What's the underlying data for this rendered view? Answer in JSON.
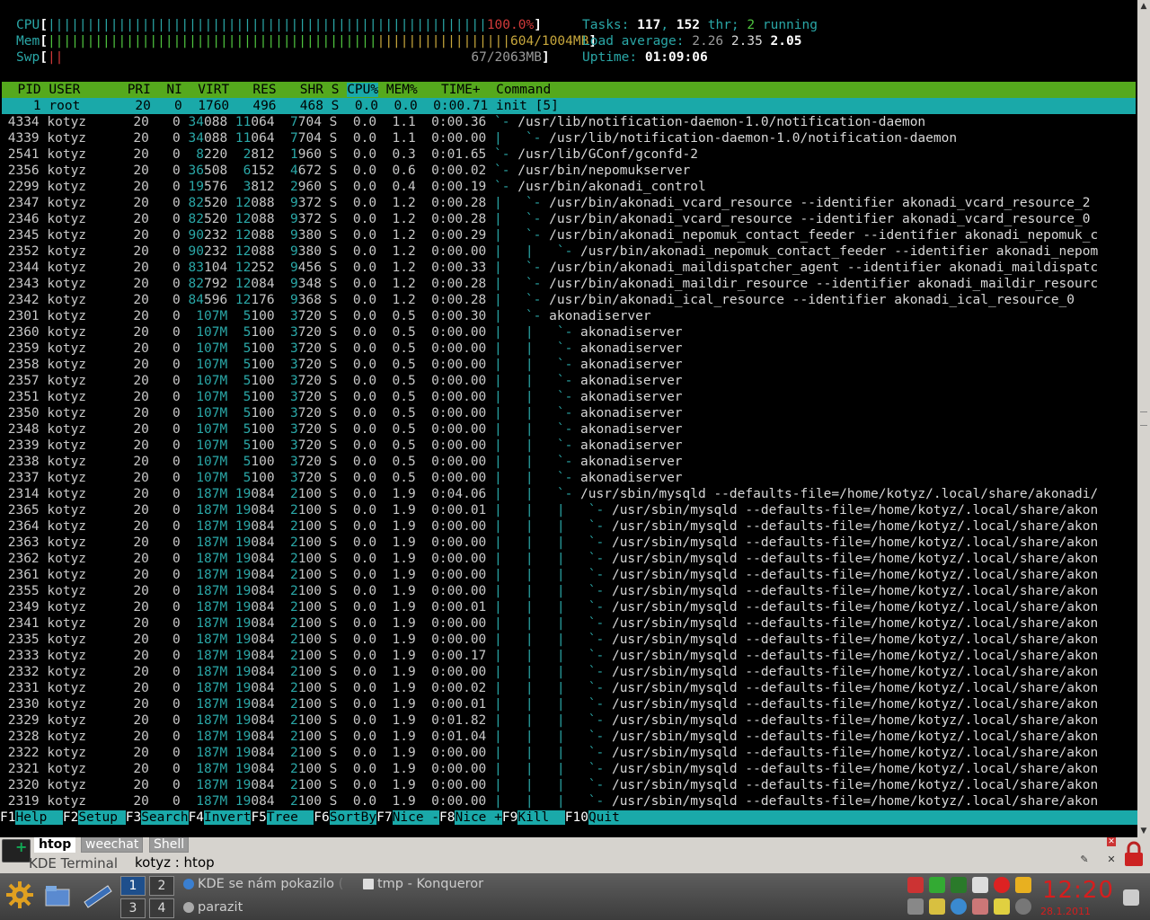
{
  "meters": {
    "cpu_label": "CPU",
    "cpu_bar": "||||||||||||||||||||||||||||||||||||||||||||||||||||||||",
    "cpu_value": "100.0%",
    "mem_label": "Mem",
    "mem_bar_green": "||||||||||||||||||||||||||||||||||||||||||",
    "mem_bar_yellow": "|||||||||||||||||",
    "mem_value": "604/1004MB",
    "swp_label": "Swp",
    "swp_bar": "||",
    "swp_value": "67/2063MB"
  },
  "stats": {
    "tasks_label": "Tasks:",
    "tasks": "117",
    "threads": "152",
    "thr_label": "thr;",
    "running": "2",
    "running_label": "running",
    "load_label": "Load average:",
    "load1": "2.26",
    "load5": "2.35",
    "load15": "2.05",
    "uptime_label": "Uptime:",
    "uptime": "01:09:06"
  },
  "columns": [
    "PID",
    "USER",
    "PRI",
    "NI",
    "VIRT",
    "RES",
    "SHR",
    "S",
    "CPU%",
    "MEM%",
    "TIME+",
    "Command"
  ],
  "processes": [
    {
      "pid": "1",
      "user": "root",
      "pri": "20",
      "ni": "0",
      "virt": "1760",
      "res": "496",
      "shr": "468",
      "s": "S",
      "cpu": "0.0",
      "mem": "0.0",
      "time": "0:00.71",
      "tree": "",
      "cmd": "init [5]"
    },
    {
      "pid": "4334",
      "user": "kotyz",
      "pri": "20",
      "ni": "0",
      "virt": "34088",
      "res": "11064",
      "shr": "7704",
      "s": "S",
      "cpu": "0.0",
      "mem": "1.1",
      "time": "0:00.36",
      "tree": "`- ",
      "cmd": "/usr/lib/notification-daemon-1.0/notification-daemon"
    },
    {
      "pid": "4339",
      "user": "kotyz",
      "pri": "20",
      "ni": "0",
      "virt": "34088",
      "res": "11064",
      "shr": "7704",
      "s": "S",
      "cpu": "0.0",
      "mem": "1.1",
      "time": "0:00.00",
      "tree": "|   `- ",
      "cmd": "/usr/lib/notification-daemon-1.0/notification-daemon"
    },
    {
      "pid": "2541",
      "user": "kotyz",
      "pri": "20",
      "ni": "0",
      "virt": "8220",
      "res": "2812",
      "shr": "1960",
      "s": "S",
      "cpu": "0.0",
      "mem": "0.3",
      "time": "0:01.65",
      "tree": "`- ",
      "cmd": "/usr/lib/GConf/gconfd-2"
    },
    {
      "pid": "2356",
      "user": "kotyz",
      "pri": "20",
      "ni": "0",
      "virt": "36508",
      "res": "6152",
      "shr": "4672",
      "s": "S",
      "cpu": "0.0",
      "mem": "0.6",
      "time": "0:00.02",
      "tree": "`- ",
      "cmd": "/usr/bin/nepomukserver"
    },
    {
      "pid": "2299",
      "user": "kotyz",
      "pri": "20",
      "ni": "0",
      "virt": "19576",
      "res": "3812",
      "shr": "2960",
      "s": "S",
      "cpu": "0.0",
      "mem": "0.4",
      "time": "0:00.19",
      "tree": "`- ",
      "cmd": "/usr/bin/akonadi_control"
    },
    {
      "pid": "2347",
      "user": "kotyz",
      "pri": "20",
      "ni": "0",
      "virt": "82520",
      "res": "12088",
      "shr": "9372",
      "s": "S",
      "cpu": "0.0",
      "mem": "1.2",
      "time": "0:00.28",
      "tree": "|   `- ",
      "cmd": "/usr/bin/akonadi_vcard_resource --identifier akonadi_vcard_resource_2"
    },
    {
      "pid": "2346",
      "user": "kotyz",
      "pri": "20",
      "ni": "0",
      "virt": "82520",
      "res": "12088",
      "shr": "9372",
      "s": "S",
      "cpu": "0.0",
      "mem": "1.2",
      "time": "0:00.28",
      "tree": "|   `- ",
      "cmd": "/usr/bin/akonadi_vcard_resource --identifier akonadi_vcard_resource_0"
    },
    {
      "pid": "2345",
      "user": "kotyz",
      "pri": "20",
      "ni": "0",
      "virt": "90232",
      "res": "12088",
      "shr": "9380",
      "s": "S",
      "cpu": "0.0",
      "mem": "1.2",
      "time": "0:00.29",
      "tree": "|   `- ",
      "cmd": "/usr/bin/akonadi_nepomuk_contact_feeder --identifier akonadi_nepomuk_c"
    },
    {
      "pid": "2352",
      "user": "kotyz",
      "pri": "20",
      "ni": "0",
      "virt": "90232",
      "res": "12088",
      "shr": "9380",
      "s": "S",
      "cpu": "0.0",
      "mem": "1.2",
      "time": "0:00.00",
      "tree": "|   |   `- ",
      "cmd": "/usr/bin/akonadi_nepomuk_contact_feeder --identifier akonadi_nepom"
    },
    {
      "pid": "2344",
      "user": "kotyz",
      "pri": "20",
      "ni": "0",
      "virt": "83104",
      "res": "12252",
      "shr": "9456",
      "s": "S",
      "cpu": "0.0",
      "mem": "1.2",
      "time": "0:00.33",
      "tree": "|   `- ",
      "cmd": "/usr/bin/akonadi_maildispatcher_agent --identifier akonadi_maildispatc"
    },
    {
      "pid": "2343",
      "user": "kotyz",
      "pri": "20",
      "ni": "0",
      "virt": "82792",
      "res": "12084",
      "shr": "9348",
      "s": "S",
      "cpu": "0.0",
      "mem": "1.2",
      "time": "0:00.28",
      "tree": "|   `- ",
      "cmd": "/usr/bin/akonadi_maildir_resource --identifier akonadi_maildir_resourc"
    },
    {
      "pid": "2342",
      "user": "kotyz",
      "pri": "20",
      "ni": "0",
      "virt": "84596",
      "res": "12176",
      "shr": "9368",
      "s": "S",
      "cpu": "0.0",
      "mem": "1.2",
      "time": "0:00.28",
      "tree": "|   `- ",
      "cmd": "/usr/bin/akonadi_ical_resource --identifier akonadi_ical_resource_0"
    },
    {
      "pid": "2301",
      "user": "kotyz",
      "pri": "20",
      "ni": "0",
      "virt": "107M",
      "res": "5100",
      "shr": "3720",
      "s": "S",
      "cpu": "0.0",
      "mem": "0.5",
      "time": "0:00.30",
      "tree": "|   `- ",
      "cmd": "akonadiserver"
    },
    {
      "pid": "2360",
      "user": "kotyz",
      "pri": "20",
      "ni": "0",
      "virt": "107M",
      "res": "5100",
      "shr": "3720",
      "s": "S",
      "cpu": "0.0",
      "mem": "0.5",
      "time": "0:00.00",
      "tree": "|   |   `- ",
      "cmd": "akonadiserver"
    },
    {
      "pid": "2359",
      "user": "kotyz",
      "pri": "20",
      "ni": "0",
      "virt": "107M",
      "res": "5100",
      "shr": "3720",
      "s": "S",
      "cpu": "0.0",
      "mem": "0.5",
      "time": "0:00.00",
      "tree": "|   |   `- ",
      "cmd": "akonadiserver"
    },
    {
      "pid": "2358",
      "user": "kotyz",
      "pri": "20",
      "ni": "0",
      "virt": "107M",
      "res": "5100",
      "shr": "3720",
      "s": "S",
      "cpu": "0.0",
      "mem": "0.5",
      "time": "0:00.00",
      "tree": "|   |   `- ",
      "cmd": "akonadiserver"
    },
    {
      "pid": "2357",
      "user": "kotyz",
      "pri": "20",
      "ni": "0",
      "virt": "107M",
      "res": "5100",
      "shr": "3720",
      "s": "S",
      "cpu": "0.0",
      "mem": "0.5",
      "time": "0:00.00",
      "tree": "|   |   `- ",
      "cmd": "akonadiserver"
    },
    {
      "pid": "2351",
      "user": "kotyz",
      "pri": "20",
      "ni": "0",
      "virt": "107M",
      "res": "5100",
      "shr": "3720",
      "s": "S",
      "cpu": "0.0",
      "mem": "0.5",
      "time": "0:00.00",
      "tree": "|   |   `- ",
      "cmd": "akonadiserver"
    },
    {
      "pid": "2350",
      "user": "kotyz",
      "pri": "20",
      "ni": "0",
      "virt": "107M",
      "res": "5100",
      "shr": "3720",
      "s": "S",
      "cpu": "0.0",
      "mem": "0.5",
      "time": "0:00.00",
      "tree": "|   |   `- ",
      "cmd": "akonadiserver"
    },
    {
      "pid": "2348",
      "user": "kotyz",
      "pri": "20",
      "ni": "0",
      "virt": "107M",
      "res": "5100",
      "shr": "3720",
      "s": "S",
      "cpu": "0.0",
      "mem": "0.5",
      "time": "0:00.00",
      "tree": "|   |   `- ",
      "cmd": "akonadiserver"
    },
    {
      "pid": "2339",
      "user": "kotyz",
      "pri": "20",
      "ni": "0",
      "virt": "107M",
      "res": "5100",
      "shr": "3720",
      "s": "S",
      "cpu": "0.0",
      "mem": "0.5",
      "time": "0:00.00",
      "tree": "|   |   `- ",
      "cmd": "akonadiserver"
    },
    {
      "pid": "2338",
      "user": "kotyz",
      "pri": "20",
      "ni": "0",
      "virt": "107M",
      "res": "5100",
      "shr": "3720",
      "s": "S",
      "cpu": "0.0",
      "mem": "0.5",
      "time": "0:00.00",
      "tree": "|   |   `- ",
      "cmd": "akonadiserver"
    },
    {
      "pid": "2337",
      "user": "kotyz",
      "pri": "20",
      "ni": "0",
      "virt": "107M",
      "res": "5100",
      "shr": "3720",
      "s": "S",
      "cpu": "0.0",
      "mem": "0.5",
      "time": "0:00.00",
      "tree": "|   |   `- ",
      "cmd": "akonadiserver"
    },
    {
      "pid": "2314",
      "user": "kotyz",
      "pri": "20",
      "ni": "0",
      "virt": "187M",
      "res": "19084",
      "shr": "2100",
      "s": "S",
      "cpu": "0.0",
      "mem": "1.9",
      "time": "0:04.06",
      "tree": "|   |   `- ",
      "cmd": "/usr/sbin/mysqld --defaults-file=/home/kotyz/.local/share/akonadi/"
    },
    {
      "pid": "2365",
      "user": "kotyz",
      "pri": "20",
      "ni": "0",
      "virt": "187M",
      "res": "19084",
      "shr": "2100",
      "s": "S",
      "cpu": "0.0",
      "mem": "1.9",
      "time": "0:00.01",
      "tree": "|   |   |   `- ",
      "cmd": "/usr/sbin/mysqld --defaults-file=/home/kotyz/.local/share/akon"
    },
    {
      "pid": "2364",
      "user": "kotyz",
      "pri": "20",
      "ni": "0",
      "virt": "187M",
      "res": "19084",
      "shr": "2100",
      "s": "S",
      "cpu": "0.0",
      "mem": "1.9",
      "time": "0:00.00",
      "tree": "|   |   |   `- ",
      "cmd": "/usr/sbin/mysqld --defaults-file=/home/kotyz/.local/share/akon"
    },
    {
      "pid": "2363",
      "user": "kotyz",
      "pri": "20",
      "ni": "0",
      "virt": "187M",
      "res": "19084",
      "shr": "2100",
      "s": "S",
      "cpu": "0.0",
      "mem": "1.9",
      "time": "0:00.00",
      "tree": "|   |   |   `- ",
      "cmd": "/usr/sbin/mysqld --defaults-file=/home/kotyz/.local/share/akon"
    },
    {
      "pid": "2362",
      "user": "kotyz",
      "pri": "20",
      "ni": "0",
      "virt": "187M",
      "res": "19084",
      "shr": "2100",
      "s": "S",
      "cpu": "0.0",
      "mem": "1.9",
      "time": "0:00.00",
      "tree": "|   |   |   `- ",
      "cmd": "/usr/sbin/mysqld --defaults-file=/home/kotyz/.local/share/akon"
    },
    {
      "pid": "2361",
      "user": "kotyz",
      "pri": "20",
      "ni": "0",
      "virt": "187M",
      "res": "19084",
      "shr": "2100",
      "s": "S",
      "cpu": "0.0",
      "mem": "1.9",
      "time": "0:00.00",
      "tree": "|   |   |   `- ",
      "cmd": "/usr/sbin/mysqld --defaults-file=/home/kotyz/.local/share/akon"
    },
    {
      "pid": "2355",
      "user": "kotyz",
      "pri": "20",
      "ni": "0",
      "virt": "187M",
      "res": "19084",
      "shr": "2100",
      "s": "S",
      "cpu": "0.0",
      "mem": "1.9",
      "time": "0:00.00",
      "tree": "|   |   |   `- ",
      "cmd": "/usr/sbin/mysqld --defaults-file=/home/kotyz/.local/share/akon"
    },
    {
      "pid": "2349",
      "user": "kotyz",
      "pri": "20",
      "ni": "0",
      "virt": "187M",
      "res": "19084",
      "shr": "2100",
      "s": "S",
      "cpu": "0.0",
      "mem": "1.9",
      "time": "0:00.01",
      "tree": "|   |   |   `- ",
      "cmd": "/usr/sbin/mysqld --defaults-file=/home/kotyz/.local/share/akon"
    },
    {
      "pid": "2341",
      "user": "kotyz",
      "pri": "20",
      "ni": "0",
      "virt": "187M",
      "res": "19084",
      "shr": "2100",
      "s": "S",
      "cpu": "0.0",
      "mem": "1.9",
      "time": "0:00.00",
      "tree": "|   |   |   `- ",
      "cmd": "/usr/sbin/mysqld --defaults-file=/home/kotyz/.local/share/akon"
    },
    {
      "pid": "2335",
      "user": "kotyz",
      "pri": "20",
      "ni": "0",
      "virt": "187M",
      "res": "19084",
      "shr": "2100",
      "s": "S",
      "cpu": "0.0",
      "mem": "1.9",
      "time": "0:00.00",
      "tree": "|   |   |   `- ",
      "cmd": "/usr/sbin/mysqld --defaults-file=/home/kotyz/.local/share/akon"
    },
    {
      "pid": "2333",
      "user": "kotyz",
      "pri": "20",
      "ni": "0",
      "virt": "187M",
      "res": "19084",
      "shr": "2100",
      "s": "S",
      "cpu": "0.0",
      "mem": "1.9",
      "time": "0:00.17",
      "tree": "|   |   |   `- ",
      "cmd": "/usr/sbin/mysqld --defaults-file=/home/kotyz/.local/share/akon"
    },
    {
      "pid": "2332",
      "user": "kotyz",
      "pri": "20",
      "ni": "0",
      "virt": "187M",
      "res": "19084",
      "shr": "2100",
      "s": "S",
      "cpu": "0.0",
      "mem": "1.9",
      "time": "0:00.00",
      "tree": "|   |   |   `- ",
      "cmd": "/usr/sbin/mysqld --defaults-file=/home/kotyz/.local/share/akon"
    },
    {
      "pid": "2331",
      "user": "kotyz",
      "pri": "20",
      "ni": "0",
      "virt": "187M",
      "res": "19084",
      "shr": "2100",
      "s": "S",
      "cpu": "0.0",
      "mem": "1.9",
      "time": "0:00.02",
      "tree": "|   |   |   `- ",
      "cmd": "/usr/sbin/mysqld --defaults-file=/home/kotyz/.local/share/akon"
    },
    {
      "pid": "2330",
      "user": "kotyz",
      "pri": "20",
      "ni": "0",
      "virt": "187M",
      "res": "19084",
      "shr": "2100",
      "s": "S",
      "cpu": "0.0",
      "mem": "1.9",
      "time": "0:00.01",
      "tree": "|   |   |   `- ",
      "cmd": "/usr/sbin/mysqld --defaults-file=/home/kotyz/.local/share/akon"
    },
    {
      "pid": "2329",
      "user": "kotyz",
      "pri": "20",
      "ni": "0",
      "virt": "187M",
      "res": "19084",
      "shr": "2100",
      "s": "S",
      "cpu": "0.0",
      "mem": "1.9",
      "time": "0:01.82",
      "tree": "|   |   |   `- ",
      "cmd": "/usr/sbin/mysqld --defaults-file=/home/kotyz/.local/share/akon"
    },
    {
      "pid": "2328",
      "user": "kotyz",
      "pri": "20",
      "ni": "0",
      "virt": "187M",
      "res": "19084",
      "shr": "2100",
      "s": "S",
      "cpu": "0.0",
      "mem": "1.9",
      "time": "0:01.04",
      "tree": "|   |   |   `- ",
      "cmd": "/usr/sbin/mysqld --defaults-file=/home/kotyz/.local/share/akon"
    },
    {
      "pid": "2322",
      "user": "kotyz",
      "pri": "20",
      "ni": "0",
      "virt": "187M",
      "res": "19084",
      "shr": "2100",
      "s": "S",
      "cpu": "0.0",
      "mem": "1.9",
      "time": "0:00.00",
      "tree": "|   |   |   `- ",
      "cmd": "/usr/sbin/mysqld --defaults-file=/home/kotyz/.local/share/akon"
    },
    {
      "pid": "2321",
      "user": "kotyz",
      "pri": "20",
      "ni": "0",
      "virt": "187M",
      "res": "19084",
      "shr": "2100",
      "s": "S",
      "cpu": "0.0",
      "mem": "1.9",
      "time": "0:00.00",
      "tree": "|   |   |   `- ",
      "cmd": "/usr/sbin/mysqld --defaults-file=/home/kotyz/.local/share/akon"
    },
    {
      "pid": "2320",
      "user": "kotyz",
      "pri": "20",
      "ni": "0",
      "virt": "187M",
      "res": "19084",
      "shr": "2100",
      "s": "S",
      "cpu": "0.0",
      "mem": "1.9",
      "time": "0:00.00",
      "tree": "|   |   |   `- ",
      "cmd": "/usr/sbin/mysqld --defaults-file=/home/kotyz/.local/share/akon"
    },
    {
      "pid": "2319",
      "user": "kotyz",
      "pri": "20",
      "ni": "0",
      "virt": "187M",
      "res": "19084",
      "shr": "2100",
      "s": "S",
      "cpu": "0.0",
      "mem": "1.9",
      "time": "0:00.00",
      "tree": "|   |   |   `- ",
      "cmd": "/usr/sbin/mysqld --defaults-file=/home/kotyz/.local/share/akon"
    }
  ],
  "fkeys": [
    {
      "key": "F1",
      "label": "Help  "
    },
    {
      "key": "F2",
      "label": "Setup "
    },
    {
      "key": "F3",
      "label": "Search"
    },
    {
      "key": "F4",
      "label": "Invert"
    },
    {
      "key": "F5",
      "label": "Tree  "
    },
    {
      "key": "F6",
      "label": "SortBy"
    },
    {
      "key": "F7",
      "label": "Nice -"
    },
    {
      "key": "F8",
      "label": "Nice +"
    },
    {
      "key": "F9",
      "label": "Kill  "
    },
    {
      "key": "F10",
      "label": "Quit"
    }
  ],
  "konsole": {
    "tabs": [
      "htop",
      "weechat",
      "Shell"
    ],
    "app_name": "KDE Terminal",
    "title": "kotyz : htop"
  },
  "taskbar": {
    "pager": [
      "1",
      "2",
      "3",
      "4"
    ],
    "tasks": [
      "KDE se nám pokazilo",
      "tmp - Konqueror",
      "parazit"
    ],
    "clock": "12:20",
    "date": "28.1.2011"
  }
}
